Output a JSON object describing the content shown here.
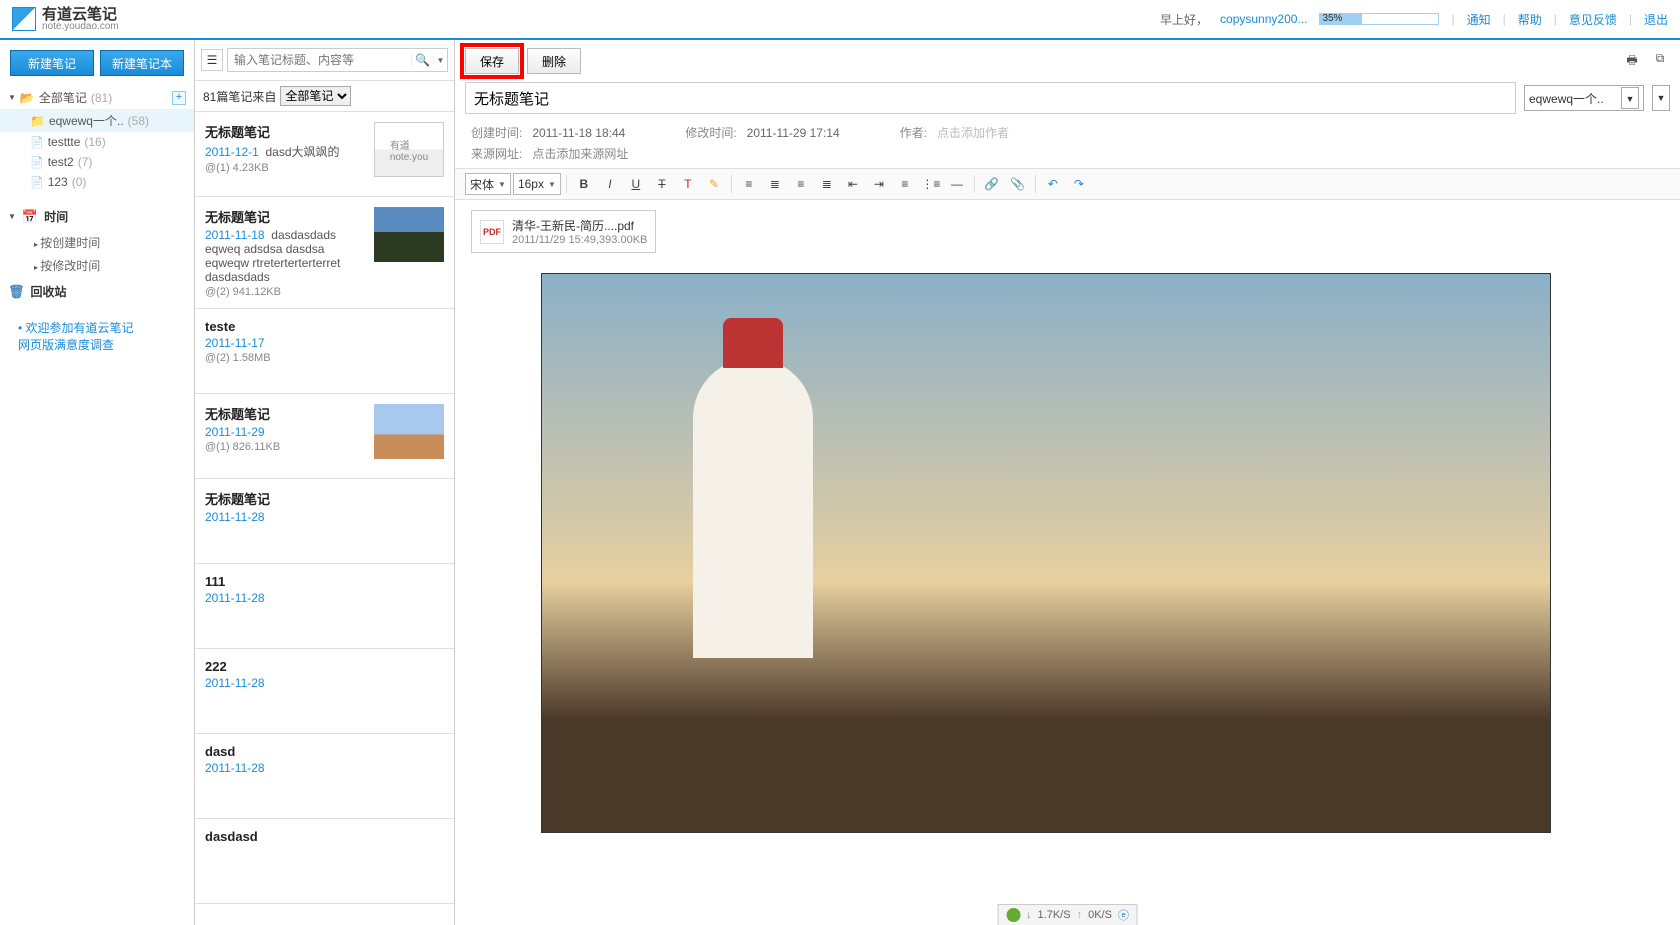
{
  "header": {
    "brand_main": "有道云笔记",
    "brand_sub": "note.youdao.com",
    "greeting": "早上好，",
    "username": "copysunny200...",
    "progress_text": "35%",
    "links": {
      "notify": "通知",
      "help": "帮助",
      "feedback": "意见反馈",
      "logout": "退出"
    }
  },
  "sidebar": {
    "new_note": "新建笔记",
    "new_notebook": "新建笔记本",
    "all_notes": "全部笔记",
    "all_notes_count": "(81)",
    "folders": [
      {
        "name": "eqwewq一个..",
        "count": "(58)"
      },
      {
        "name": "testtte",
        "count": "(16)"
      },
      {
        "name": "test2",
        "count": "(7)"
      },
      {
        "name": "123",
        "count": "(0)"
      }
    ],
    "time_section": "时间",
    "time_subs": [
      "按创建时间",
      "按修改时间"
    ],
    "trash": "回收站",
    "survey_link1": "欢迎参加有道云笔记",
    "survey_link2": "网页版满意度调查"
  },
  "notelist": {
    "search_placeholder": "输入笔记标题、内容等",
    "count_prefix": "81篇笔记来自",
    "filter_value": "全部笔记",
    "notes": [
      {
        "title": "无标题笔记",
        "date": "2011-12-1",
        "snippet": "dasd大飒飒的",
        "meta": "@(1) 4.23KB",
        "thumb": "logo"
      },
      {
        "title": "无标题笔记",
        "date": "2011-11-18",
        "snippet": "dasdasdads eqweq adsdsa dasdsa eqweqw rtreterterterterret dasdasdads",
        "meta": "@(2) 941.12KB",
        "thumb": "sunset"
      },
      {
        "title": "teste",
        "date": "2011-11-17",
        "snippet": "",
        "meta": "@(2) 1.58MB",
        "thumb": ""
      },
      {
        "title": "无标题笔记",
        "date": "2011-11-29",
        "snippet": "",
        "meta": "@(1) 826.11KB",
        "thumb": "desert"
      },
      {
        "title": "无标题笔记",
        "date": "2011-11-28",
        "snippet": "",
        "meta": "",
        "thumb": ""
      },
      {
        "title": "111",
        "date": "2011-11-28",
        "snippet": "",
        "meta": "",
        "thumb": ""
      },
      {
        "title": "222",
        "date": "2011-11-28",
        "snippet": "",
        "meta": "",
        "thumb": ""
      },
      {
        "title": "dasd",
        "date": "2011-11-28",
        "snippet": "",
        "meta": "",
        "thumb": ""
      },
      {
        "title": "dasdasd",
        "date": "",
        "snippet": "",
        "meta": "",
        "thumb": ""
      }
    ]
  },
  "editor": {
    "save_btn": "保存",
    "delete_btn": "删除",
    "title_value": "无标题笔记",
    "folder_value": "eqwewq一个..",
    "meta": {
      "created_lbl": "创建时间:",
      "created_val": "2011-11-18 18:44",
      "modified_lbl": "修改时间:",
      "modified_val": "2011-11-29 17:14",
      "author_lbl": "作者:",
      "author_ph": "点击添加作者",
      "source_lbl": "来源网址:",
      "source_ph": "点击添加来源网址"
    },
    "toolbar": {
      "font_label": "宋体",
      "size_label": "16px"
    },
    "attachment": {
      "name": "清华-王新民-简历....pdf",
      "sub": "2011/11/29 15:49,393.00KB"
    }
  },
  "netbar": {
    "down": "1.7K/S",
    "up": "0K/S"
  }
}
